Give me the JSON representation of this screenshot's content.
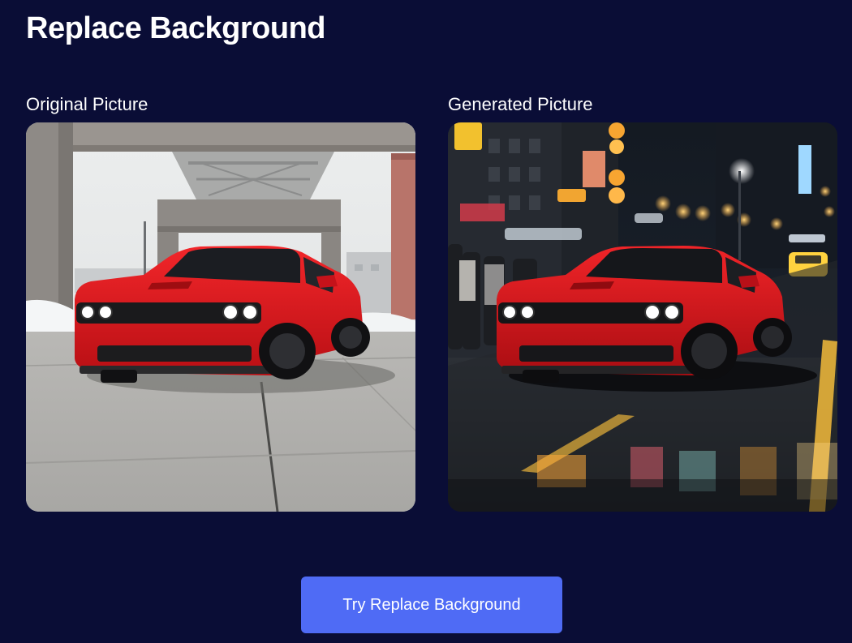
{
  "page": {
    "title": "Replace Background"
  },
  "panels": {
    "original": {
      "label": "Original Picture"
    },
    "generated": {
      "label": "Generated Picture"
    }
  },
  "cta": {
    "label": "Try Replace Background"
  },
  "colors": {
    "background": "#0a0d36",
    "button": "#4f6bf5",
    "text": "#ffffff",
    "car": "#e0161b"
  }
}
